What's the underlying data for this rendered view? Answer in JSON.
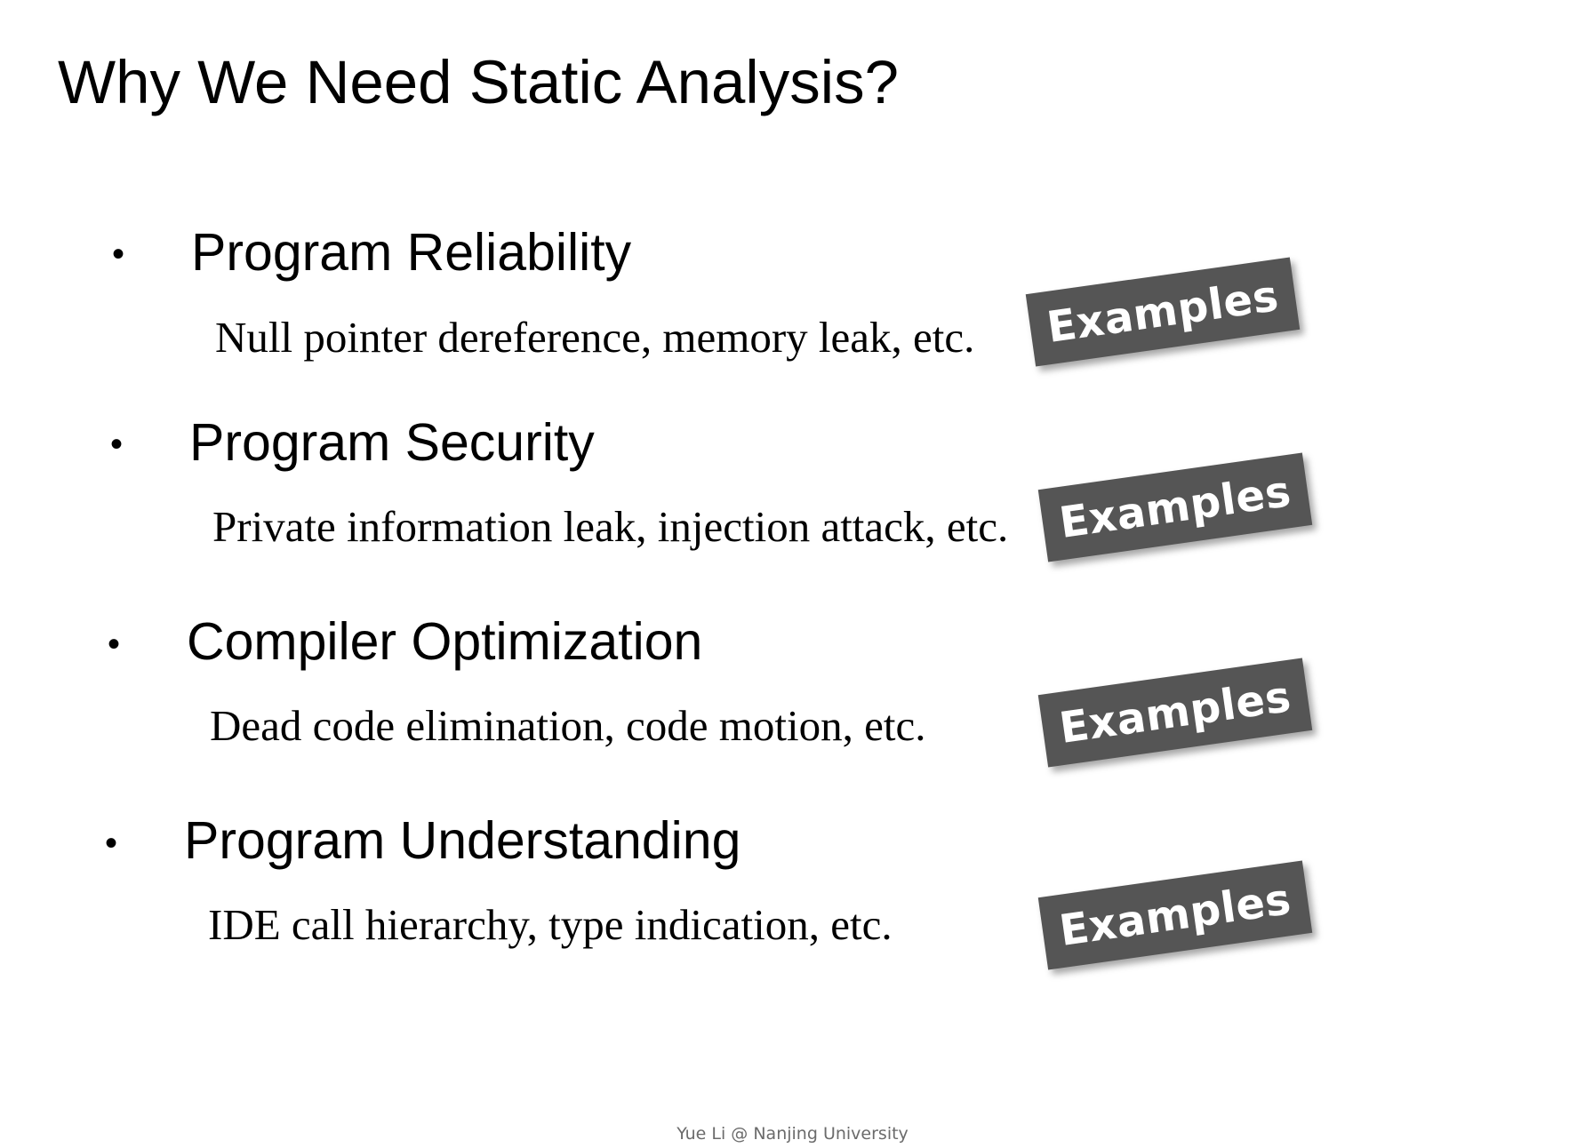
{
  "slide": {
    "title": "Why We Need Static Analysis?",
    "bullet_char": "•",
    "items": [
      {
        "heading": "Program Reliability",
        "description": "Null pointer dereference, memory leak, etc.",
        "button_label": "Examples"
      },
      {
        "heading": "Program Security",
        "description": "Private information leak, injection attack, etc.",
        "button_label": "Examples"
      },
      {
        "heading": "Compiler Optimization",
        "description": "Dead code elimination, code motion, etc.",
        "button_label": "Examples"
      },
      {
        "heading": "Program Understanding",
        "description": "IDE call hierarchy, type indication, etc.",
        "button_label": "Examples"
      }
    ],
    "footer": "Yue Li @ Nanjing University"
  },
  "colors": {
    "background": "#ffffff",
    "text": "#000000",
    "button_background": "#555555",
    "button_text": "#ffffff",
    "footer_text": "#6b6b6b"
  }
}
